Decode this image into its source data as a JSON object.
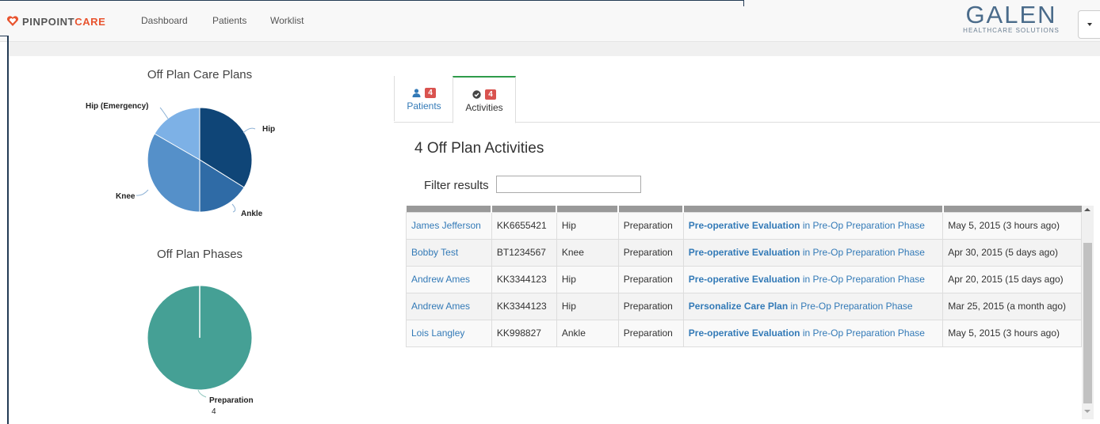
{
  "brand": {
    "name_prefix": "PINPOINT",
    "name_accent": "CARE",
    "accent_color": "#e8542f"
  },
  "nav": {
    "items": [
      "Dashboard",
      "Patients",
      "Worklist"
    ]
  },
  "partner_logo": {
    "name": "GALEN",
    "tagline": "HEALTHCARE SOLUTIONS"
  },
  "care_plans_chart": {
    "title": "Off Plan Care Plans",
    "labels": [
      "Hip",
      "Ankle",
      "Knee",
      "Hip (Emergency)"
    ]
  },
  "phases_chart": {
    "title": "Off Plan Phases",
    "label": "Preparation",
    "value_label": "4"
  },
  "chart_data": [
    {
      "type": "pie",
      "title": "Off Plan Care Plans",
      "categories": [
        "Hip",
        "Ankle",
        "Knee",
        "Hip (Emergency)"
      ],
      "values": [
        1,
        1,
        1,
        1
      ],
      "colors": [
        "#0f4577",
        "#2f6ba6",
        "#5590c9",
        "#7db1e6"
      ]
    },
    {
      "type": "pie",
      "title": "Off Plan Phases",
      "categories": [
        "Preparation"
      ],
      "values": [
        4
      ],
      "colors": [
        "#45a095"
      ]
    }
  ],
  "tabs": [
    {
      "label": "Patients",
      "badge": "4",
      "icon": "user-icon"
    },
    {
      "label": "Activities",
      "badge": "4",
      "icon": "check-circle-icon"
    }
  ],
  "activities": {
    "title": "4 Off Plan Activities",
    "filter_label": "Filter results",
    "filter_placeholder": "",
    "rows": [
      {
        "patient": "James Jefferson",
        "mrn": "KK6655421",
        "plan": "Hip",
        "phase": "Preparation",
        "activity": "Pre-operative Evaluation",
        "connector": " in ",
        "phase_full": "Pre-Op Preparation Phase",
        "date": "May 5, 2015 (3 hours ago)"
      },
      {
        "patient": "Bobby Test",
        "mrn": "BT1234567",
        "plan": "Knee",
        "phase": "Preparation",
        "activity": "Pre-operative Evaluation",
        "connector": " in ",
        "phase_full": "Pre-Op Preparation Phase",
        "date": "Apr 30, 2015 (5 days ago)"
      },
      {
        "patient": "Andrew Ames",
        "mrn": "KK3344123",
        "plan": "Hip",
        "phase": "Preparation",
        "activity": "Pre-operative Evaluation",
        "connector": " in ",
        "phase_full": "Pre-Op Preparation Phase",
        "date": "Apr 20, 2015 (15 days ago)"
      },
      {
        "patient": "Andrew Ames",
        "mrn": "KK3344123",
        "plan": "Hip",
        "phase": "Preparation",
        "activity": "Personalize Care Plan",
        "connector": " in ",
        "phase_full": "Pre-Op Preparation Phase",
        "date": "Mar 25, 2015 (a month ago)"
      },
      {
        "patient": "Lois Langley",
        "mrn": "KK998827",
        "plan": "Ankle",
        "phase": "Preparation",
        "activity": "Pre-operative Evaluation",
        "connector": " in ",
        "phase_full": "Pre-Op Preparation Phase",
        "date": "May 5, 2015 (3 hours ago)"
      }
    ]
  }
}
